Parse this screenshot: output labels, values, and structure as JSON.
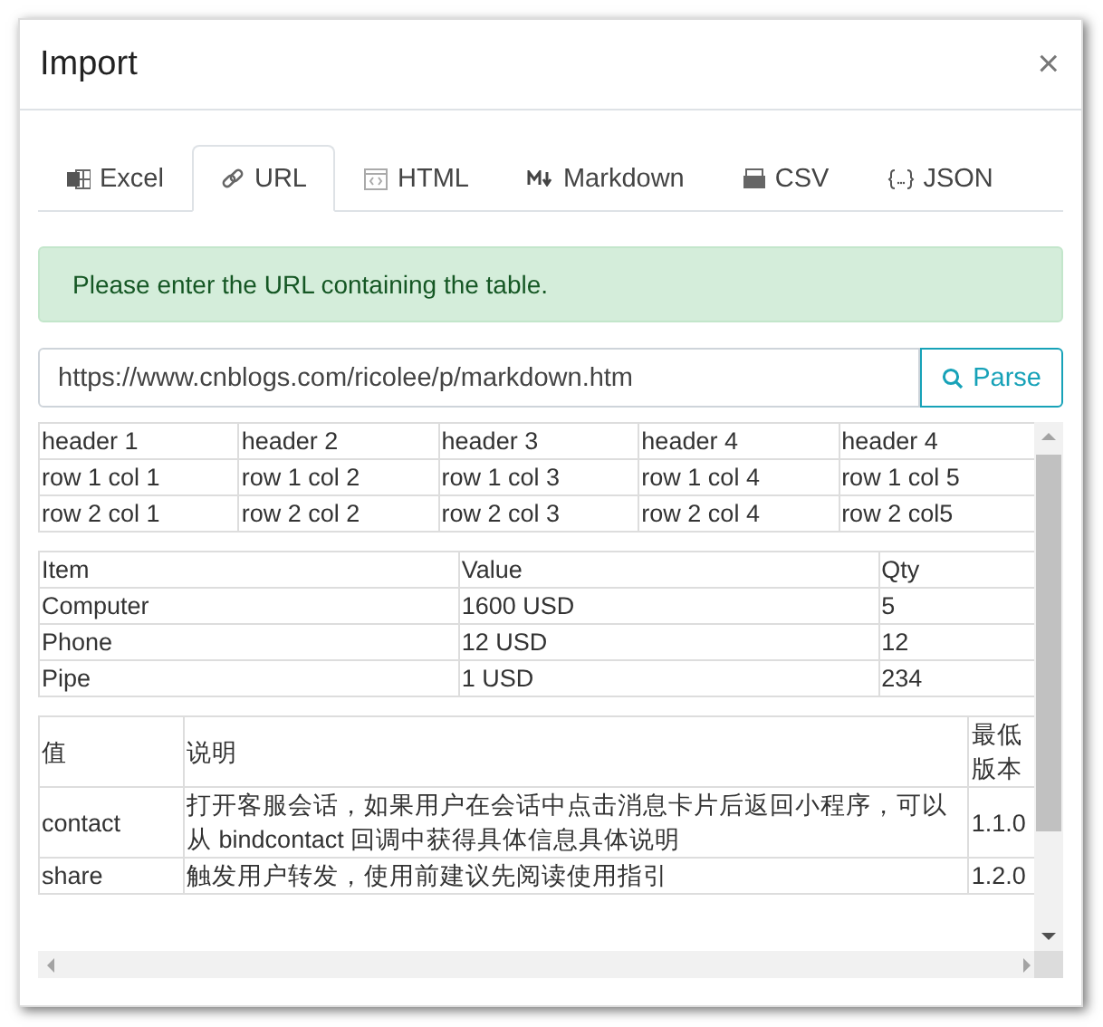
{
  "dialog": {
    "title": "Import",
    "close": "×"
  },
  "tabs": [
    {
      "label": "Excel",
      "selected": false
    },
    {
      "label": "URL",
      "selected": true
    },
    {
      "label": "HTML",
      "selected": false
    },
    {
      "label": "Markdown",
      "selected": false
    },
    {
      "label": "CSV",
      "selected": false
    },
    {
      "label": "JSON",
      "selected": false
    }
  ],
  "alert": "Please enter the URL containing the table.",
  "url_field": {
    "value": "https://www.cnblogs.com/ricolee/p/markdown.htm"
  },
  "parse_button": "Parse",
  "tables": [
    {
      "rows": [
        [
          "header 1",
          "header 2",
          "header 3",
          "header 4",
          "header 4"
        ],
        [
          "row 1 col 1",
          "row 1 col 2",
          "row 1 col 3",
          "row 1 col 4",
          "row 1 col 5"
        ],
        [
          "row 2 col 1",
          "row 2 col 2",
          "row 2 col 3",
          "row 2 col 4",
          "row 2 col5"
        ]
      ]
    },
    {
      "rows": [
        [
          "Item",
          "Value",
          "Qty"
        ],
        [
          "Computer",
          "1600 USD",
          "5"
        ],
        [
          "Phone",
          "12 USD",
          "12"
        ],
        [
          "Pipe",
          "1 USD",
          "234"
        ]
      ]
    },
    {
      "rows": [
        [
          "值",
          "说明",
          "最低版本"
        ],
        [
          "contact",
          "打开客服会话，如果用户在会话中点击消息卡片后返回小程序，可以从 bindcontact 回调中获得具体信息具体说明",
          "1.1.0"
        ],
        [
          "share",
          "触发用户转发，使用前建议先阅读使用指引",
          "1.2.0"
        ]
      ]
    }
  ]
}
